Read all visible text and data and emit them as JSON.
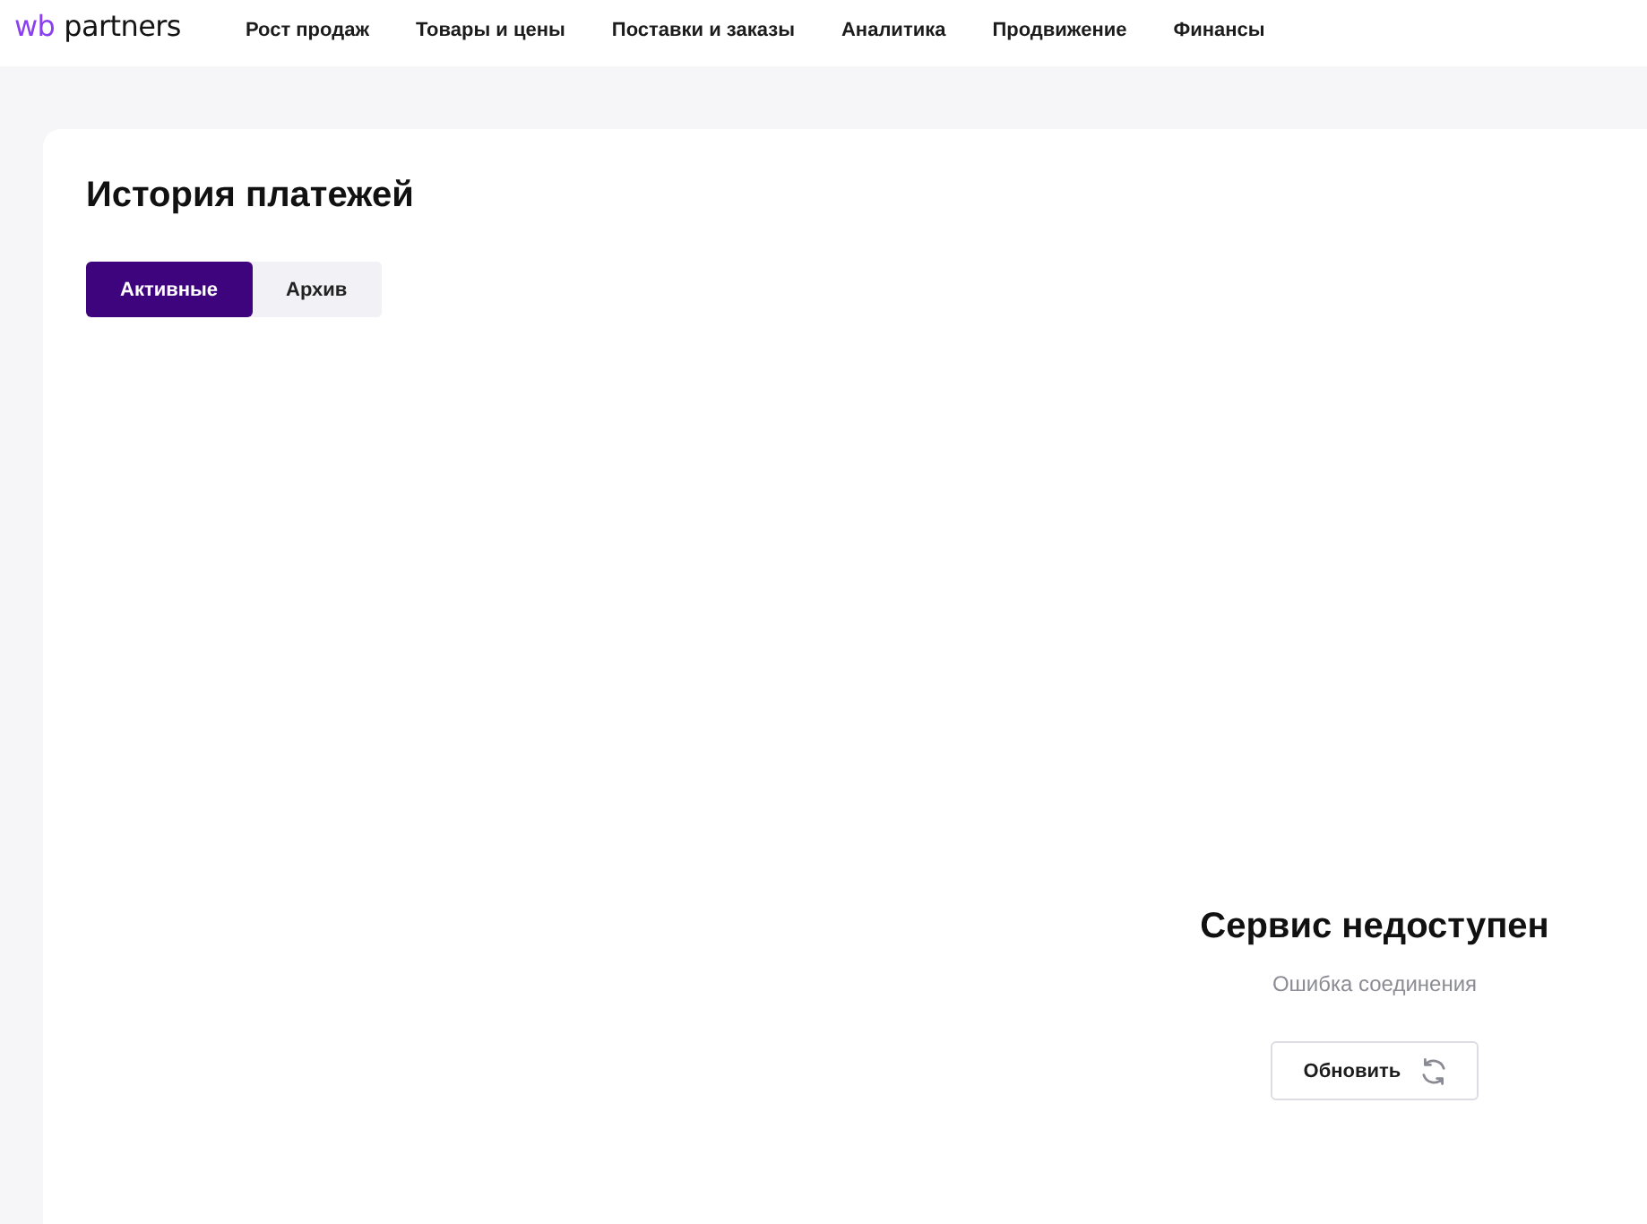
{
  "logo": {
    "prefix": "wb",
    "name": "partners"
  },
  "nav": [
    {
      "label": "Рост продаж",
      "selected": false
    },
    {
      "label": "Товары и цены",
      "selected": false
    },
    {
      "label": "Поставки и заказы",
      "selected": false
    },
    {
      "label": "Аналитика",
      "selected": false
    },
    {
      "label": "Продвижение",
      "selected": false
    },
    {
      "label": "Финансы",
      "selected": false
    }
  ],
  "page": {
    "title": "История платежей"
  },
  "tabs": [
    {
      "label": "Активные",
      "selected": true
    },
    {
      "label": "Архив",
      "selected": false
    }
  ],
  "error": {
    "title": "Сервис недоступен",
    "message": "Ошибка соединения",
    "button": "Обновить"
  }
}
